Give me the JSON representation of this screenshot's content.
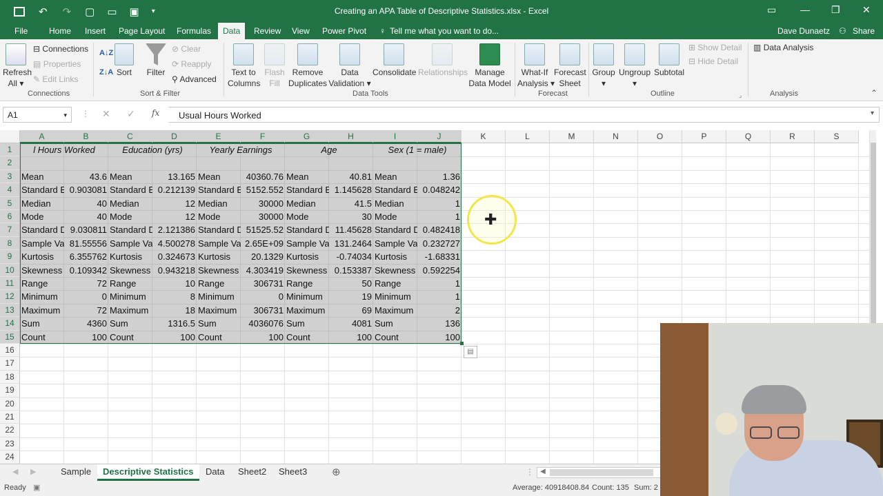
{
  "window": {
    "title": "Creating an APA Table of Descriptive Statistics.xlsx - Excel",
    "user": "Dave Dunaetz",
    "share_label": "Share"
  },
  "ribbon_tabs": [
    "File",
    "Home",
    "Insert",
    "Page Layout",
    "Formulas",
    "Data",
    "Review",
    "View",
    "Power Pivot"
  ],
  "tell_me": "Tell me what you want to do...",
  "ribbon": {
    "refresh_all": [
      "Refresh",
      "All"
    ],
    "connections": "Connections",
    "properties": "Properties",
    "edit_links": "Edit Links",
    "connections_group": "Connections",
    "sort": "Sort",
    "filter": "Filter",
    "clear": "Clear",
    "reapply": "Reapply",
    "advanced": "Advanced",
    "sort_filter_group": "Sort & Filter",
    "text_to_columns": [
      "Text to",
      "Columns"
    ],
    "flash_fill": [
      "Flash",
      "Fill"
    ],
    "remove_duplicates": [
      "Remove",
      "Duplicates"
    ],
    "data_validation": [
      "Data",
      "Validation"
    ],
    "consolidate": "Consolidate",
    "relationships": "Relationships",
    "manage_data_model": [
      "Manage",
      "Data Model"
    ],
    "data_tools_group": "Data Tools",
    "what_if": [
      "What-If",
      "Analysis"
    ],
    "forecast_sheet": [
      "Forecast",
      "Sheet"
    ],
    "forecast_group": "Forecast",
    "group": "Group",
    "ungroup": "Ungroup",
    "subtotal": "Subtotal",
    "show_detail": "Show Detail",
    "hide_detail": "Hide Detail",
    "outline_group": "Outline",
    "data_analysis": "Data Analysis",
    "analysis_group": "Analysis"
  },
  "formula_bar": {
    "name_box": "A1",
    "fx": "fx",
    "value": "Usual Hours Worked"
  },
  "columns": [
    "A",
    "B",
    "C",
    "D",
    "E",
    "F",
    "G",
    "H",
    "I",
    "J",
    "K",
    "L",
    "M",
    "N",
    "O",
    "P",
    "Q",
    "R",
    "S"
  ],
  "rows": [
    "1",
    "2",
    "3",
    "4",
    "5",
    "6",
    "7",
    "8",
    "9",
    "10",
    "11",
    "12",
    "13",
    "14",
    "15",
    "16",
    "17",
    "18",
    "19",
    "20",
    "21",
    "22",
    "23",
    "24"
  ],
  "headers": [
    "l Hours Worked",
    "Education (yrs)",
    "Yearly Earnings",
    "Age",
    "Sex (1 = male)"
  ],
  "table": [
    [
      "Mean",
      "43.6",
      "Mean",
      "13.165",
      "Mean",
      "40360.76",
      "Mean",
      "40.81",
      "Mean",
      "1.36"
    ],
    [
      "Standard E",
      "0.903081",
      "Standard E",
      "0.212139",
      "Standard E",
      "5152.552",
      "Standard E",
      "1.145628",
      "Standard E",
      "0.048242"
    ],
    [
      "Median",
      "40",
      "Median",
      "12",
      "Median",
      "30000",
      "Median",
      "41.5",
      "Median",
      "1"
    ],
    [
      "Mode",
      "40",
      "Mode",
      "12",
      "Mode",
      "30000",
      "Mode",
      "30",
      "Mode",
      "1"
    ],
    [
      "Standard D",
      "9.030811",
      "Standard D",
      "2.121386",
      "Standard D",
      "51525.52",
      "Standard D",
      "11.45628",
      "Standard D",
      "0.482418"
    ],
    [
      "Sample Va",
      "81.55556",
      "Sample Va",
      "4.500278",
      "Sample Va",
      "2.65E+09",
      "Sample Va",
      "131.2464",
      "Sample Va",
      "0.232727"
    ],
    [
      "Kurtosis",
      "6.355762",
      "Kurtosis",
      "0.324673",
      "Kurtosis",
      "20.1329",
      "Kurtosis",
      "-0.74034",
      "Kurtosis",
      "-1.68331"
    ],
    [
      "Skewness",
      "0.109342",
      "Skewness",
      "0.943218",
      "Skewness",
      "4.303419",
      "Skewness",
      "0.153387",
      "Skewness",
      "0.592254"
    ],
    [
      "Range",
      "72",
      "Range",
      "10",
      "Range",
      "306731",
      "Range",
      "50",
      "Range",
      "1"
    ],
    [
      "Minimum",
      "0",
      "Minimum",
      "8",
      "Minimum",
      "0",
      "Minimum",
      "19",
      "Minimum",
      "1"
    ],
    [
      "Maximum",
      "72",
      "Maximum",
      "18",
      "Maximum",
      "306731",
      "Maximum",
      "69",
      "Maximum",
      "2"
    ],
    [
      "Sum",
      "4360",
      "Sum",
      "1316.5",
      "Sum",
      "4036076",
      "Sum",
      "4081",
      "Sum",
      "136"
    ],
    [
      "Count",
      "100",
      "Count",
      "100",
      "Count",
      "100",
      "Count",
      "100",
      "Count",
      "100"
    ]
  ],
  "sheet_tabs": [
    "Sample",
    "Descriptive Statistics",
    "Data",
    "Sheet2",
    "Sheet3"
  ],
  "active_sheet": "Descriptive Statistics",
  "status": {
    "ready": "Ready",
    "average": "Average: 40918408.84",
    "count": "Count: 135",
    "sum": "Sum: 2"
  },
  "colors": {
    "accent": "#217346",
    "selection": "#a0a0a0",
    "cursor_highlight": "#f2e64a"
  }
}
